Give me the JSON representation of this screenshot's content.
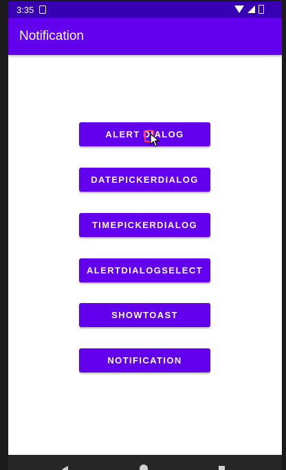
{
  "status_bar": {
    "time": "3:35"
  },
  "app_bar": {
    "title": "Notification"
  },
  "buttons": [
    {
      "label": "ALERT DIALOG"
    },
    {
      "label": "DATEPICKERDIALOG"
    },
    {
      "label": "TIMEPICKERDIALOG"
    },
    {
      "label": "ALERTDIALOGSELECT"
    },
    {
      "label": "SHOWTOAST"
    },
    {
      "label": "NOTIFICATION"
    }
  ],
  "colors": {
    "primary": "#6200ee",
    "primary_dark": "#3700b3",
    "on_primary": "#ffffff",
    "background": "#ffffff"
  }
}
